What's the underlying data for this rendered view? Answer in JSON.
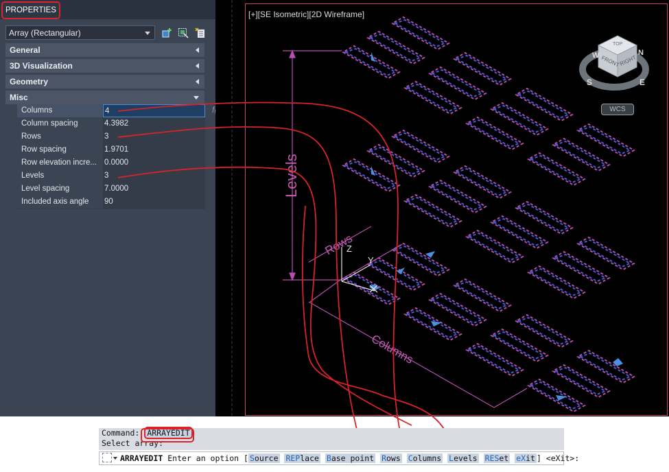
{
  "properties": {
    "title": "PROPERTIES",
    "object_type": "Array (Rectangular)",
    "sections": [
      {
        "label": "General",
        "expanded": false
      },
      {
        "label": "3D Visualization",
        "expanded": false
      },
      {
        "label": "Geometry",
        "expanded": false
      },
      {
        "label": "Misc",
        "expanded": true
      }
    ],
    "misc_rows": [
      {
        "label": "Columns",
        "value": "4"
      },
      {
        "label": "Column spacing",
        "value": "4.3982"
      },
      {
        "label": "Rows",
        "value": "3"
      },
      {
        "label": "Row spacing",
        "value": "1.9701"
      },
      {
        "label": "Row elevation incre...",
        "value": "0.0000"
      },
      {
        "label": "Levels",
        "value": "3"
      },
      {
        "label": "Level spacing",
        "value": "7.0000"
      },
      {
        "label": "Included axis angle",
        "value": "90"
      }
    ],
    "fx": "f(x)"
  },
  "viewport": {
    "label": "[+][SE Isometric][2D Wireframe]",
    "annotations": {
      "levels": "Levels",
      "rows": "Rows",
      "columns": "Columns"
    },
    "ucs": {
      "z": "Z",
      "y": "Y"
    },
    "viewcube": {
      "top": "TOP",
      "front": "FRONT",
      "right": "RIGHT",
      "w": "W",
      "n": "N",
      "s": "S",
      "e": "E"
    },
    "wcs": "WCS"
  },
  "command": {
    "line1_prefix": "Command:",
    "line1_cmd": "ARRAYEDIT",
    "line2": "Select array:",
    "prompt_cmd": "ARRAYEDIT",
    "prompt_text": "Enter an option [",
    "options": [
      {
        "key": "S",
        "rest": "ource"
      },
      {
        "key": "REP",
        "rest": "lace"
      },
      {
        "key": "B",
        "rest": "ase point"
      },
      {
        "key": "R",
        "rest": "ows"
      },
      {
        "key": "C",
        "rest": "olumns"
      },
      {
        "key": "L",
        "rest": "evels"
      },
      {
        "key": "RES",
        "rest": "et"
      },
      {
        "key": "eX",
        "rest": "it"
      }
    ],
    "prompt_end": "] <eXit>:"
  },
  "colors": {
    "panel": "#3b4453",
    "accent_red": "#d8232a",
    "array_magenta": "#b84fb0",
    "array_blue": "#4a5ad8"
  }
}
